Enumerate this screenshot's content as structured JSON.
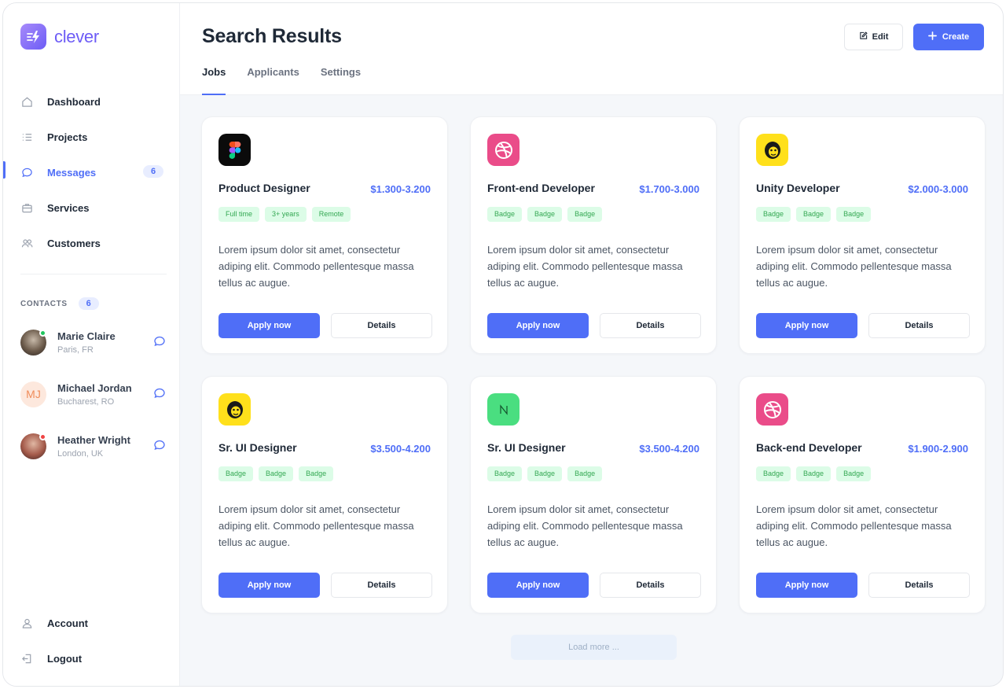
{
  "brand": {
    "name": "clever",
    "logo_icon": "bolt-icon",
    "color": "#6d5cf6"
  },
  "nav": {
    "items": [
      {
        "label": "Dashboard",
        "icon": "home-icon"
      },
      {
        "label": "Projects",
        "icon": "list-icon"
      },
      {
        "label": "Messages",
        "icon": "chat-icon",
        "badge": "6",
        "active": true
      },
      {
        "label": "Services",
        "icon": "briefcase-icon"
      },
      {
        "label": "Customers",
        "icon": "users-icon"
      }
    ],
    "bottom": [
      {
        "label": "Account",
        "icon": "user-icon"
      },
      {
        "label": "Logout",
        "icon": "logout-icon"
      }
    ]
  },
  "contacts": {
    "heading": "CONTACTS",
    "count": "6",
    "people": [
      {
        "name": "Marie Claire",
        "location": "Paris, FR",
        "status_color": "#22c55e"
      },
      {
        "name": "Michael Jordan",
        "location": "Bucharest, RO",
        "initials": "MJ"
      },
      {
        "name": "Heather Wright",
        "location": "London, UK",
        "status_color": "#ef4444"
      }
    ]
  },
  "header": {
    "title": "Search Results",
    "edit_label": "Edit",
    "create_label": "Create",
    "tabs": [
      {
        "label": "Jobs",
        "active": true
      },
      {
        "label": "Applicants"
      },
      {
        "label": "Settings"
      }
    ]
  },
  "jobs": [
    {
      "title": "Product Designer",
      "salary": "$1.300-3.200",
      "logo": "figma-icon",
      "badges": [
        "Full time",
        "3+ years",
        "Remote"
      ],
      "description": "Lorem ipsum dolor sit amet, consectetur adiping elit. Commodo pellentesque massa tellus ac augue.",
      "apply": "Apply now",
      "details": "Details"
    },
    {
      "title": "Front-end Developer",
      "salary": "$1.700-3.000",
      "logo": "dribbble-icon",
      "badges": [
        "Badge",
        "Badge",
        "Badge"
      ],
      "description": "Lorem ipsum dolor sit amet, consectetur adiping elit. Commodo pellentesque massa tellus ac augue.",
      "apply": "Apply now",
      "details": "Details"
    },
    {
      "title": "Unity Developer",
      "salary": "$2.000-3.000",
      "logo": "mailchimp-icon",
      "badges": [
        "Badge",
        "Badge",
        "Badge"
      ],
      "description": "Lorem ipsum dolor sit amet, consectetur adiping elit. Commodo pellentesque massa tellus ac augue.",
      "apply": "Apply now",
      "details": "Details"
    },
    {
      "title": "Sr. UI Designer",
      "salary": "$3.500-4.200",
      "logo": "mailchimp-icon",
      "badges": [
        "Badge",
        "Badge",
        "Badge"
      ],
      "description": "Lorem ipsum dolor sit amet, consectetur adiping elit. Commodo pellentesque massa tellus ac augue.",
      "apply": "Apply now",
      "details": "Details"
    },
    {
      "title": "Sr. UI Designer",
      "salary": "$3.500-4.200",
      "logo": "nuxt-icon",
      "badges": [
        "Badge",
        "Badge",
        "Badge"
      ],
      "description": "Lorem ipsum dolor sit amet, consectetur adiping elit. Commodo pellentesque massa tellus ac augue.",
      "apply": "Apply now",
      "details": "Details"
    },
    {
      "title": "Back-end Developer",
      "salary": "$1.900-2.900",
      "logo": "dribbble-icon",
      "badges": [
        "Badge",
        "Badge",
        "Badge"
      ],
      "description": "Lorem ipsum dolor sit amet, consectetur adiping elit. Commodo pellentesque massa tellus ac augue.",
      "apply": "Apply now",
      "details": "Details"
    }
  ],
  "load_more_label": "Load more ...",
  "colors": {
    "accent": "#4f6ef7",
    "badge_bg": "#dcfce7",
    "badge_text": "#34a853"
  }
}
